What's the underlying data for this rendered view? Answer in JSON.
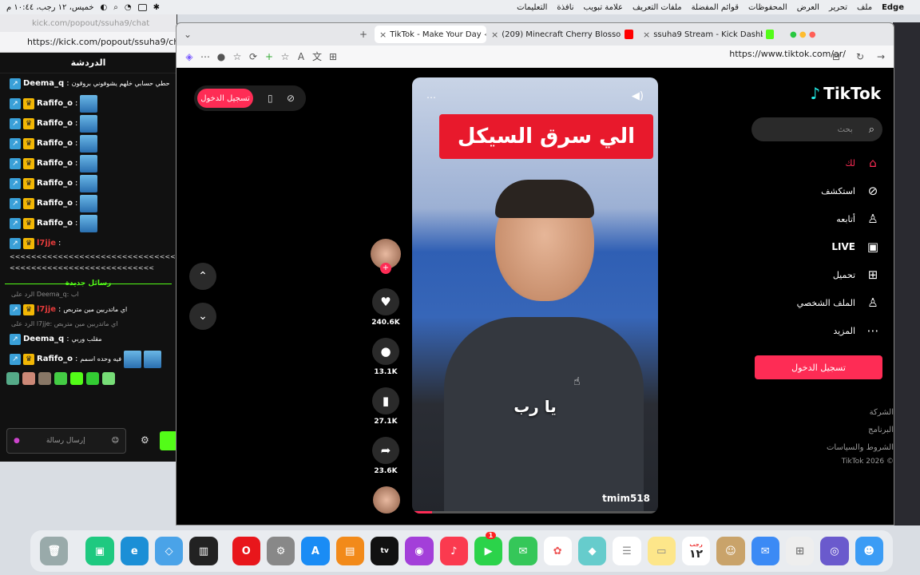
{
  "menubar": {
    "app_name": "Edge",
    "menus": [
      "Edge",
      "ملف",
      "تحرير",
      "العرض",
      "المحفوظات",
      "قوائم المفضلة",
      "ملفات التعريف",
      "علامة تبويب",
      "نافذة",
      "التعليمات"
    ],
    "clock": "خميس، ١٢ رجب، ١٠:٤٤ م"
  },
  "kick": {
    "url": "https://kick.com/popout/ssuha9/chat",
    "titlebar_url": "kick.com/popout/ssuha9/chat",
    "chat_title": "الدردشة",
    "messages": [
      {
        "user": "Deema_q",
        "text": "حطي حسابي خلهم يشوفوني بروقون"
      },
      {
        "user": "Rafifo_o",
        "text": ""
      },
      {
        "user": "Rafifo_o",
        "text": ""
      },
      {
        "user": "Rafifo_o",
        "text": ""
      },
      {
        "user": "Rafifo_o",
        "text": ""
      },
      {
        "user": "Rafifo_o",
        "text": ""
      },
      {
        "user": "Rafifo_o",
        "text": ""
      },
      {
        "user": "Rafifo_o",
        "text": ""
      },
      {
        "user": "l7jje",
        "text": ""
      }
    ],
    "spam_line_1": "<<<<<<<<<<<<<<<<<<<<<<<<<<<<<<<<<<<<<<<<",
    "spam_line_2": "<<<<<<<<<<<<<<<<<<<<<<<<<<<",
    "new_messages": "رسائل جديدة",
    "reply1_meta": "الرد على Deema_q: اب",
    "reply1_user": "l7jje",
    "reply1_text": "اي ماتدربين مين متربص",
    "reply2_meta": "الرد على l7jje: اي ماتدربين مين متربص",
    "reply2_user": "Deema_q",
    "reply2_text": "مقلب وربي",
    "last_user": "Rafifo_o",
    "last_text": "فيه وحده اسمم",
    "input_placeholder": "إرسال رسالة"
  },
  "edge": {
    "tabs": [
      {
        "label": "TikTok - Make Your Day",
        "active": true,
        "color": "#111111"
      },
      {
        "label": "(209) Minecraft Cherry Blossom",
        "active": false,
        "color": "#ff0000"
      },
      {
        "label": "ssuha9 Stream - Kick Dashboard",
        "active": false,
        "color": "#53fc18"
      }
    ],
    "address": "https://www.tiktok.com/ar/"
  },
  "tiktok": {
    "logo": "TikTok",
    "top_login": "تسجيل الدخول",
    "search_placeholder": "بحث",
    "nav": [
      {
        "label": "لك",
        "icon": "home-icon"
      },
      {
        "label": "استكشف",
        "icon": "compass-icon"
      },
      {
        "label": "أتابعه",
        "icon": "follow-icon"
      },
      {
        "label": "LIVE",
        "icon": "live-icon"
      },
      {
        "label": "تحميل",
        "icon": "upload-icon"
      },
      {
        "label": "الملف الشخصي",
        "icon": "profile-icon"
      },
      {
        "label": "المزيد",
        "icon": "more-icon"
      }
    ],
    "side_login": "تسجيل الدخول",
    "footer": [
      "الشركة",
      "البرنامج",
      "الشروط والسياسات",
      "TikTok 2026 ©"
    ],
    "video": {
      "banner": "الي سرق السيكل",
      "subtitle": "يا رب",
      "creator": "tmim518",
      "progress": 0.08
    },
    "actions": {
      "likes": "240.6K",
      "comments": "13.1K",
      "saves": "27.1K",
      "shares": "23.6K"
    }
  },
  "dock": {
    "calendar_day": "١٢",
    "calendar_month": "رجب",
    "facetime_badge": "1"
  },
  "colors": {
    "tiktok_pink": "#fe2c55",
    "kick_green": "#53fc18"
  }
}
